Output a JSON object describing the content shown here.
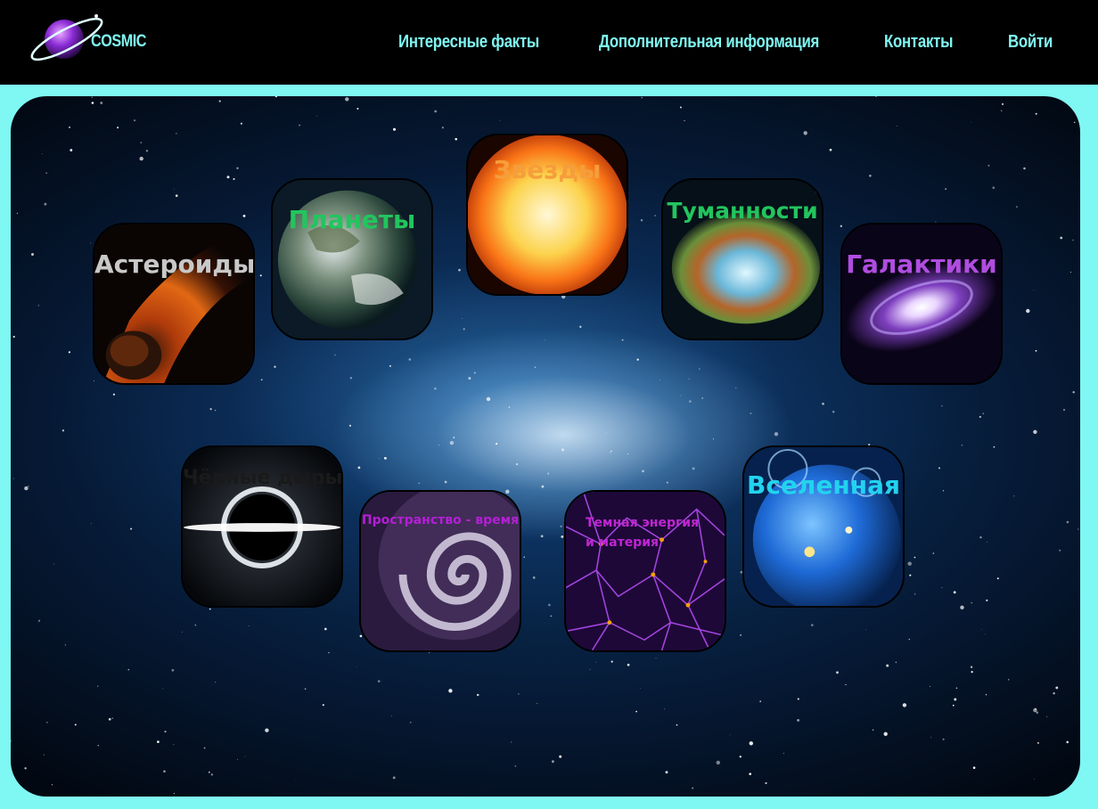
{
  "brand": {
    "name": "COSMIC",
    "logo_icon": "ringed-planet-logo-icon"
  },
  "nav": {
    "facts": "Интересные факты",
    "info": "Дополнительная информация",
    "contacts": "Контакты",
    "login": "Войти"
  },
  "colors": {
    "accent": "#7ff7f2",
    "header_bg": "#000000"
  },
  "topics": {
    "asteroids": {
      "label": "Астероиды",
      "color": "#c8c8c8"
    },
    "planets": {
      "label": "Планеты",
      "color": "#22c55e"
    },
    "stars": {
      "label": "Звёзды",
      "color": "#f59e3b"
    },
    "nebulae": {
      "label": "Туманности",
      "color": "#22c55e"
    },
    "galaxies": {
      "label": "Галактики",
      "color": "#b04de0"
    },
    "black_holes": {
      "label": "Чёрные дыры",
      "color": "#1a1a1a"
    },
    "spacetime": {
      "label": "Пространство - время",
      "color": "#b51fd6"
    },
    "dark_energy": {
      "label": "Темная энергия и материя",
      "line1": "Темная энергия",
      "line2": "и материя",
      "color": "#c026d3"
    },
    "universe": {
      "label": "Вселенная",
      "color": "#22d3ee"
    }
  }
}
